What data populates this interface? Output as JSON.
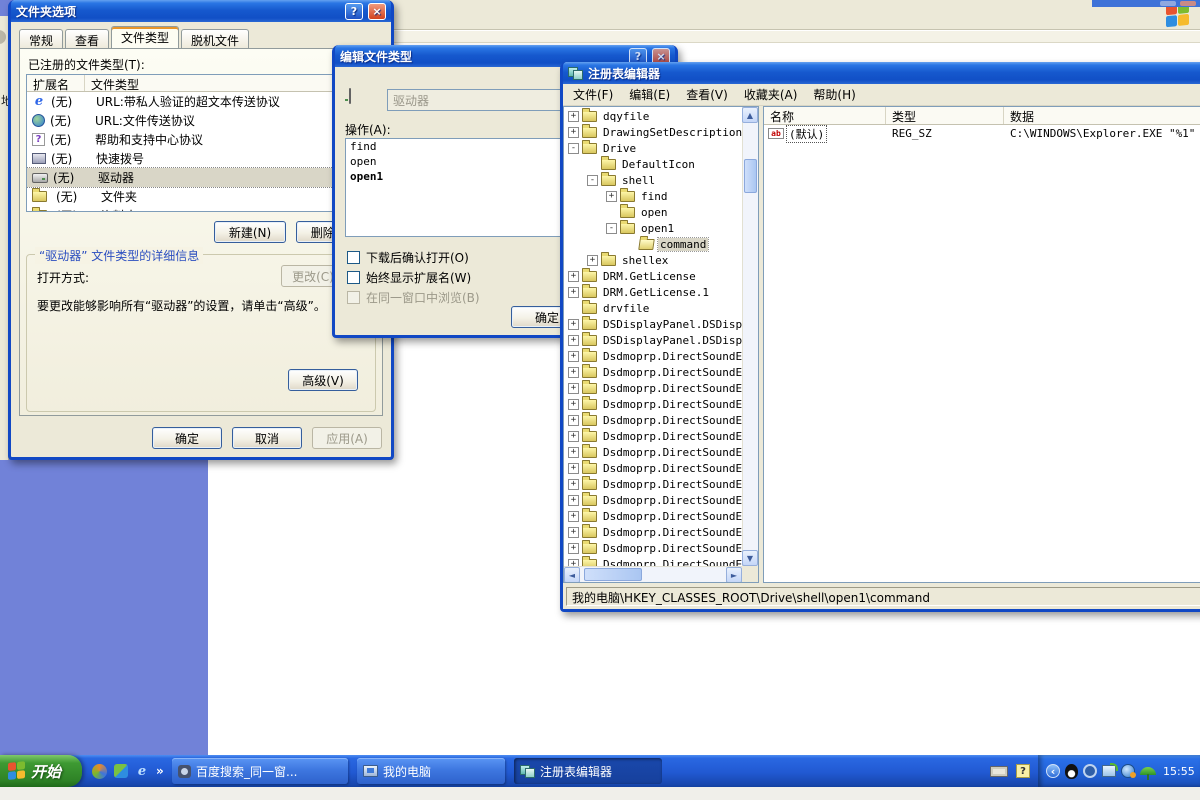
{
  "background": {
    "address_fragment": "地"
  },
  "folder_options": {
    "title": "文件夹选项",
    "help_glyph": "?",
    "close_glyph": "×",
    "tabs": [
      {
        "label": "常规"
      },
      {
        "label": "查看"
      },
      {
        "label": "文件类型",
        "active": true
      },
      {
        "label": "脱机文件"
      }
    ],
    "registered_types_label": "已注册的文件类型(T):",
    "list_columns": [
      "扩展名",
      "文件类型"
    ],
    "file_types": [
      {
        "icon": "ie-icon",
        "ext": "(无)",
        "type": "URL:带私人验证的超文本传送协议"
      },
      {
        "icon": "ftp-icon",
        "ext": "(无)",
        "type": "URL:文件传送协议"
      },
      {
        "icon": "help-center-icon",
        "ext": "(无)",
        "type": "帮助和支持中心协议"
      },
      {
        "icon": "speed-dial-icon",
        "ext": "(无)",
        "type": "快速拨号"
      },
      {
        "icon": "drive-icon",
        "ext": "(无)",
        "type": "驱动器",
        "selected": true
      },
      {
        "icon": "folder-icon",
        "ext": "(无)",
        "type": "文件夹"
      },
      {
        "icon": "folder-icon",
        "ext": "(无)",
        "type": "资料夹"
      }
    ],
    "new_button": "新建(N)",
    "delete_button": "删除(D)",
    "details_group_title": "“驱动器” 文件类型的详细信息",
    "open_with_label": "打开方式:",
    "change_button": "更改(C)",
    "advanced_hint": "要更改能够影响所有“驱动器”的设置，请单击“高级”。",
    "advanced_button": "高级(V)",
    "ok_button": "确定",
    "cancel_button": "取消",
    "apply_button": "应用(A)"
  },
  "edit_file_type": {
    "title": "编辑文件类型",
    "help_glyph": "?",
    "close_glyph": "×",
    "file_type_value": "驱动器",
    "actions_label": "操作(A):",
    "actions": [
      {
        "label": "find"
      },
      {
        "label": "open"
      },
      {
        "label": "open1",
        "bold": true
      }
    ],
    "checkboxes": [
      {
        "label": "下载后确认打开(O)",
        "checked": false
      },
      {
        "label": "始终显示扩展名(W)",
        "checked": false
      },
      {
        "label": "在同一窗口中浏览(B)",
        "checked": false,
        "disabled": true
      }
    ],
    "ok_button": "确定"
  },
  "registry_editor": {
    "title": "注册表编辑器",
    "menus": [
      {
        "label": "文件(F)"
      },
      {
        "label": "编辑(E)"
      },
      {
        "label": "查看(V)"
      },
      {
        "label": "收藏夹(A)"
      },
      {
        "label": "帮助(H)"
      }
    ],
    "tree": [
      {
        "depth": 0,
        "expander": "+",
        "label": "dqyfile"
      },
      {
        "depth": 0,
        "expander": "+",
        "label": "DrawingSetDescription"
      },
      {
        "depth": 0,
        "expander": "-",
        "label": "Drive"
      },
      {
        "depth": 1,
        "expander": "",
        "label": "DefaultIcon"
      },
      {
        "depth": 1,
        "expander": "-",
        "label": "shell"
      },
      {
        "depth": 2,
        "expander": "+",
        "label": "find"
      },
      {
        "depth": 2,
        "expander": "",
        "label": "open"
      },
      {
        "depth": 2,
        "expander": "-",
        "label": "open1"
      },
      {
        "depth": 3,
        "expander": "",
        "label": "command",
        "selected": true
      },
      {
        "depth": 1,
        "expander": "+",
        "label": "shellex"
      },
      {
        "depth": 0,
        "expander": "+",
        "label": "DRM.GetLicense"
      },
      {
        "depth": 0,
        "expander": "+",
        "label": "DRM.GetLicense.1"
      },
      {
        "depth": 0,
        "expander": "",
        "label": "drvfile"
      },
      {
        "depth": 0,
        "expander": "+",
        "label": "DSDisplayPanel.DSDisplay"
      },
      {
        "depth": 0,
        "expander": "+",
        "label": "DSDisplayPanel.DSDisplay"
      },
      {
        "depth": 0,
        "expander": "+",
        "label": "Dsdmoprp.DirectSoundEff"
      },
      {
        "depth": 0,
        "expander": "+",
        "label": "Dsdmoprp.DirectSoundEff"
      },
      {
        "depth": 0,
        "expander": "+",
        "label": "Dsdmoprp.DirectSoundEff"
      },
      {
        "depth": 0,
        "expander": "+",
        "label": "Dsdmoprp.DirectSoundEff"
      },
      {
        "depth": 0,
        "expander": "+",
        "label": "Dsdmoprp.DirectSoundEff"
      },
      {
        "depth": 0,
        "expander": "+",
        "label": "Dsdmoprp.DirectSoundEff"
      },
      {
        "depth": 0,
        "expander": "+",
        "label": "Dsdmoprp.DirectSoundEff"
      },
      {
        "depth": 0,
        "expander": "+",
        "label": "Dsdmoprp.DirectSoundEff"
      },
      {
        "depth": 0,
        "expander": "+",
        "label": "Dsdmoprp.DirectSoundEff"
      },
      {
        "depth": 0,
        "expander": "+",
        "label": "Dsdmoprp.DirectSoundEff"
      },
      {
        "depth": 0,
        "expander": "+",
        "label": "Dsdmoprp.DirectSoundEff"
      },
      {
        "depth": 0,
        "expander": "+",
        "label": "Dsdmoprp.DirectSoundEff"
      },
      {
        "depth": 0,
        "expander": "+",
        "label": "Dsdmoprp.DirectSoundEff"
      },
      {
        "depth": 0,
        "expander": "+",
        "label": "Dsdmoprp.DirectSoundEff"
      }
    ],
    "value_columns": [
      "名称",
      "类型",
      "数据"
    ],
    "values": [
      {
        "name": "(默认)",
        "type": "REG_SZ",
        "data": "C:\\WINDOWS\\Explorer.EXE \"%1\""
      }
    ],
    "status_text": "我的电脑\\HKEY_CLASSES_ROOT\\Drive\\shell\\open1\\command"
  },
  "taskbar": {
    "start_label": "开始",
    "quick_launch": [
      {
        "icon": "media-player-icon"
      },
      {
        "icon": "messenger-icon"
      },
      {
        "icon": "ie-icon",
        "glyph": "e"
      },
      {
        "icon": "chevron-right-icon",
        "glyph": "»"
      }
    ],
    "tasks": [
      {
        "icon": "baidu-icon",
        "label": "百度搜索_同一窗..."
      },
      {
        "icon": "my-computer-icon",
        "label": "我的电脑"
      },
      {
        "icon": "regedit-icon",
        "label": "注册表编辑器",
        "active": true
      }
    ],
    "tray": {
      "icons": [
        "keyboard-icon",
        "help-tray-icon",
        "collapse-chevron-icon",
        "qq-icon",
        "baidu-tray-icon",
        "network-icon",
        "globe-icon",
        "umbrella-icon"
      ],
      "clock": "15:55"
    }
  }
}
